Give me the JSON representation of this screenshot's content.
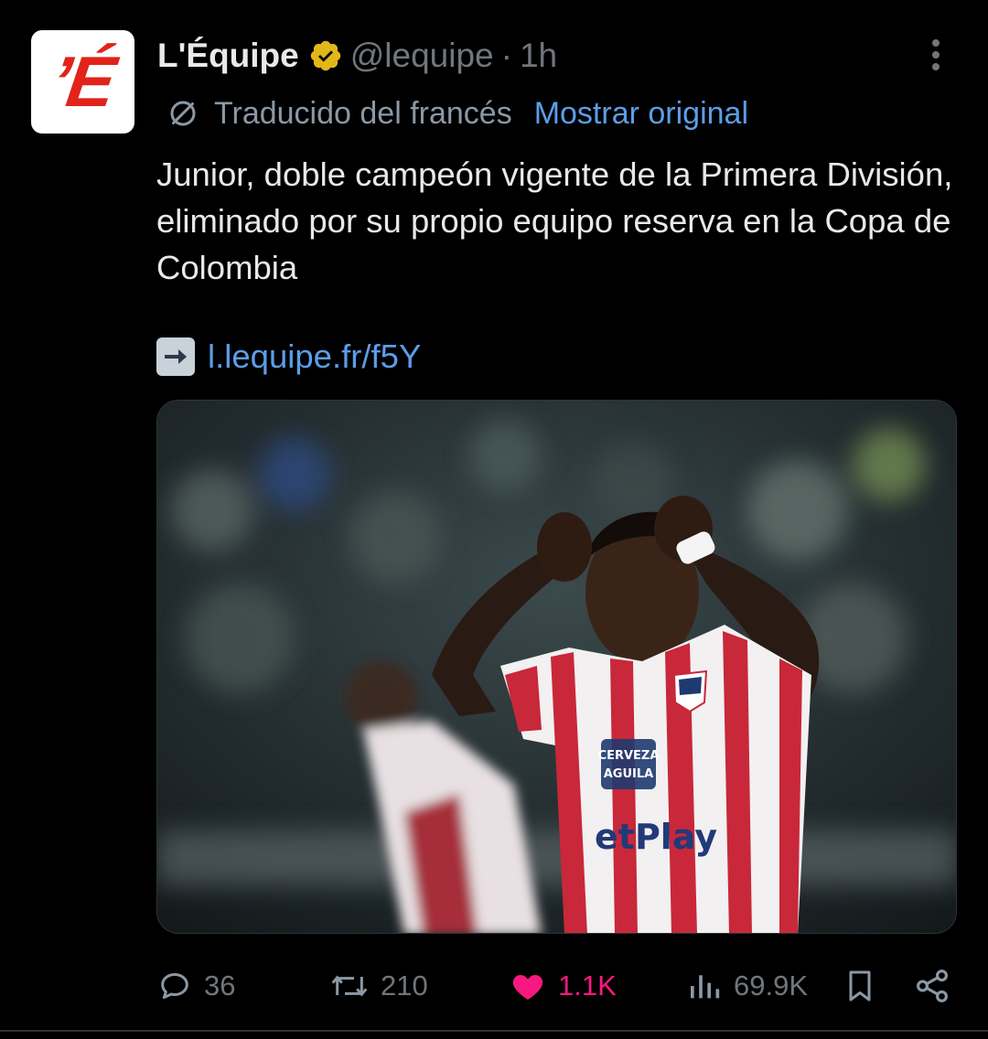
{
  "author": {
    "avatar_text": "’É",
    "display_name": "L'Équipe",
    "handle": "@lequipe",
    "separator": "·",
    "time": "1h",
    "verified_color": "#e2b719"
  },
  "translation": {
    "label": "Traducido del francés",
    "show_original": "Mostrar original"
  },
  "body": {
    "text": "Junior, doble campeón vigente de la Primera División, eliminado por su propio equipo reserva en la Copa de Colombia",
    "link": "l.lequipe.fr/f5Y"
  },
  "actions": {
    "replies": "36",
    "reposts": "210",
    "likes": "1.1K",
    "views": "69.9K"
  },
  "colors": {
    "background": "#000000",
    "text": "#e7e9ea",
    "muted": "#71767b",
    "link": "#5b9ee8",
    "like": "#f91880",
    "brand_red": "#e2231a"
  }
}
